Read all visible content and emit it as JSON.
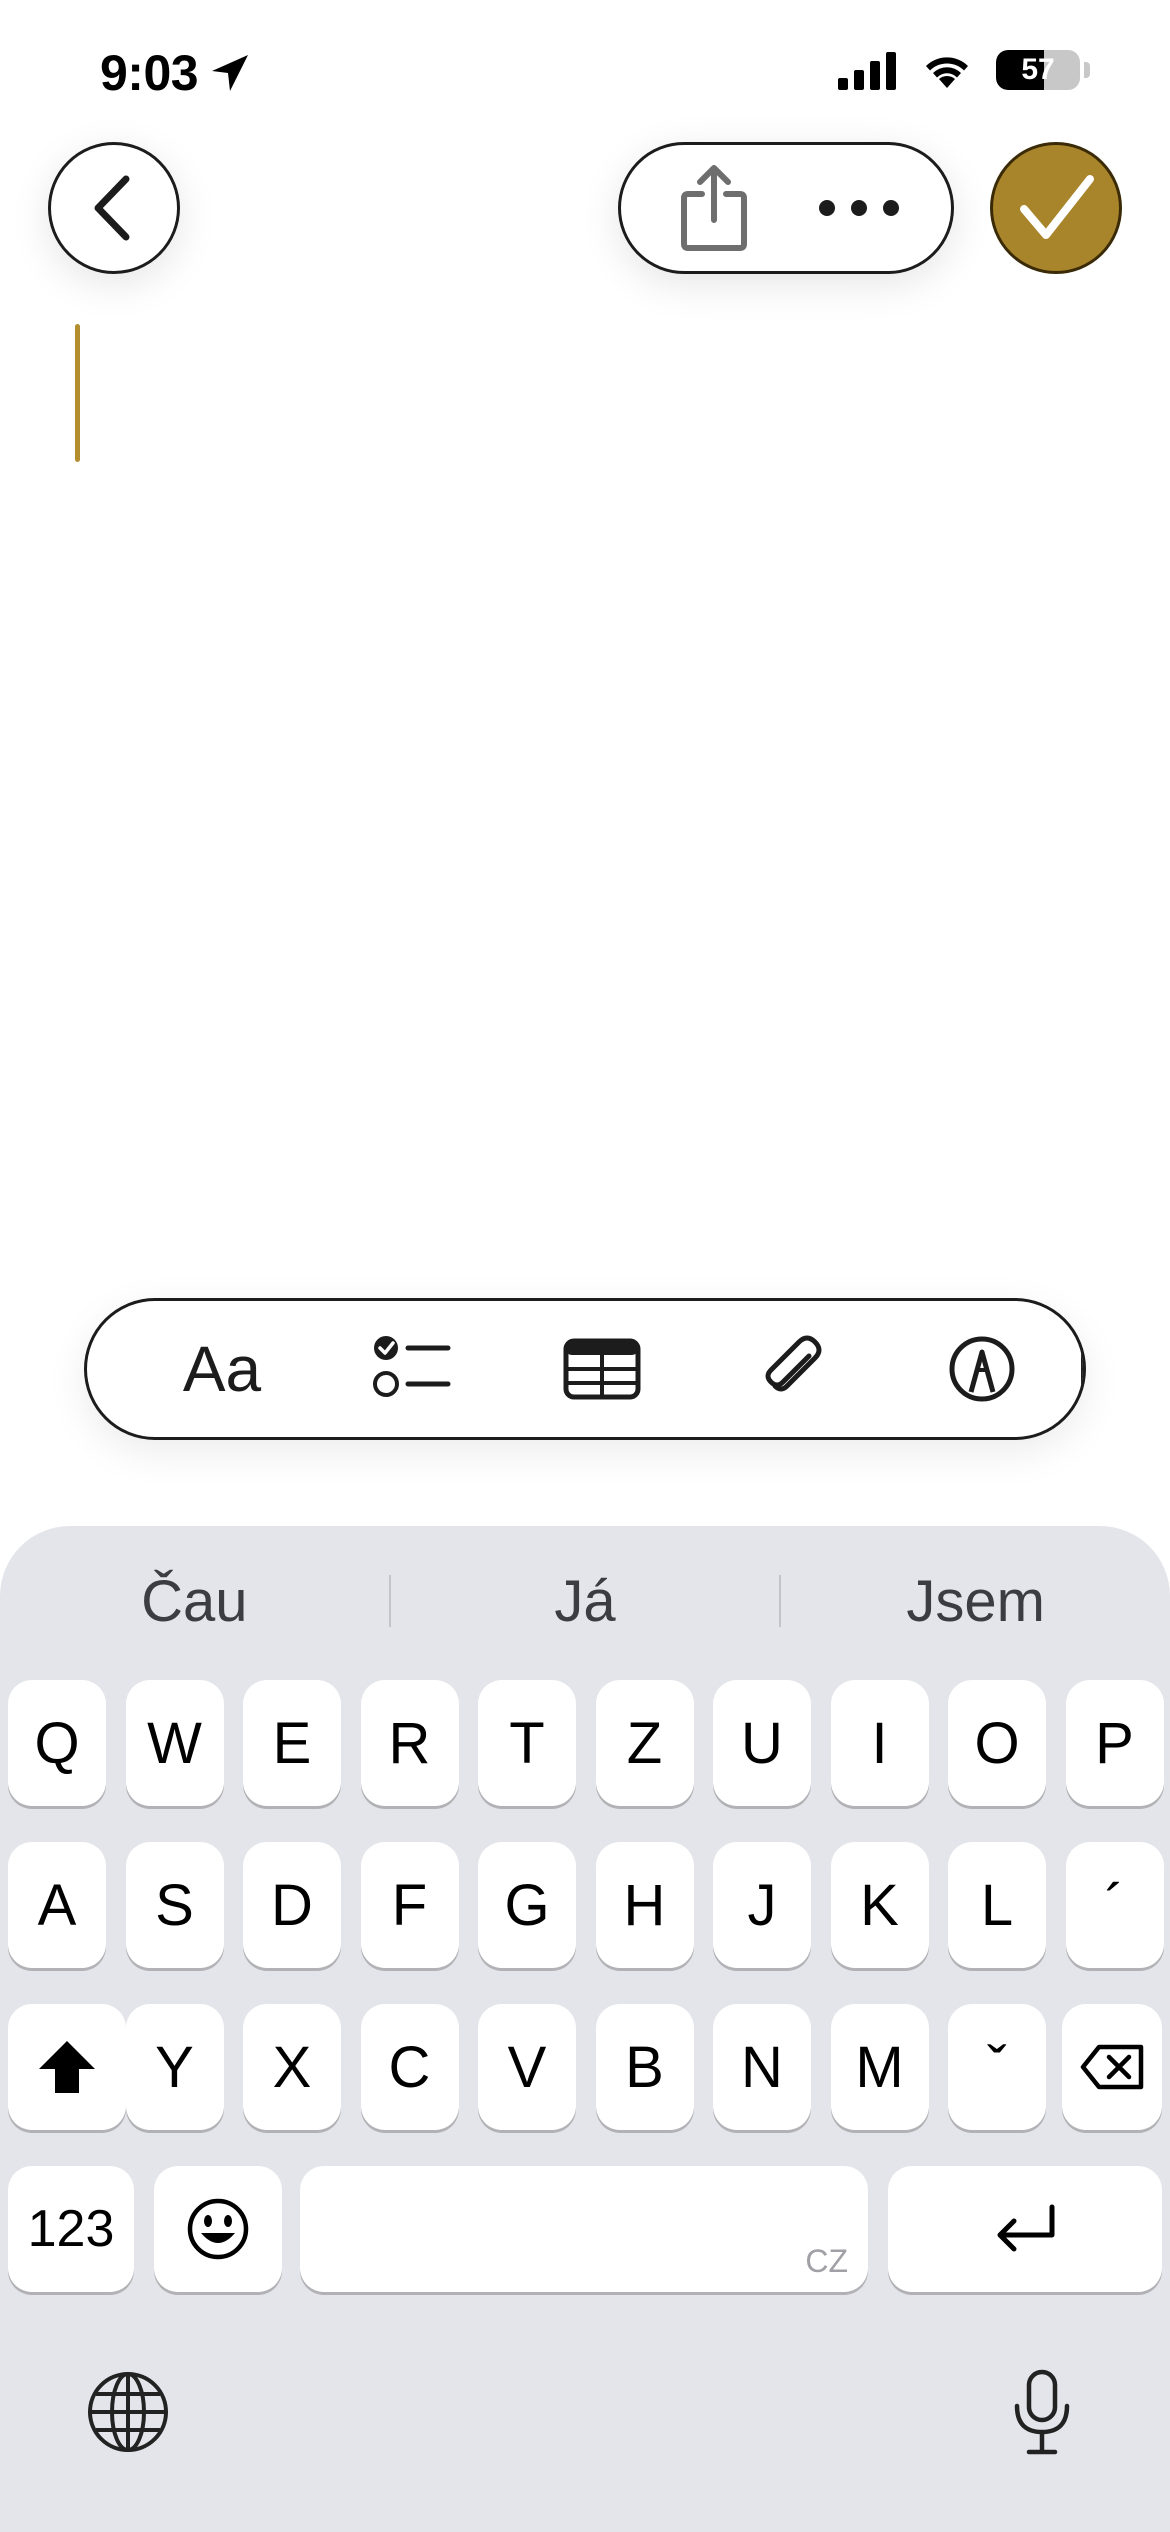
{
  "status_bar": {
    "time": "9:03",
    "battery_level": "57",
    "battery_fraction": 0.57
  },
  "nav": {
    "back_icon": "chevron-left-icon",
    "share_icon": "share-icon",
    "more_icon": "ellipsis-icon",
    "done_icon": "checkmark-icon",
    "accent_color": "#a8842a"
  },
  "format_toolbar": {
    "text_style_label": "Aa",
    "icons": [
      "text-style-icon",
      "checklist-icon",
      "table-icon",
      "attachment-icon",
      "markup-icon",
      "more-icon"
    ]
  },
  "keyboard": {
    "suggestions": [
      "Čau",
      "Já",
      "Jsem"
    ],
    "row1": [
      "Q",
      "W",
      "E",
      "R",
      "T",
      "Z",
      "U",
      "I",
      "O",
      "P"
    ],
    "row2": [
      "A",
      "S",
      "D",
      "F",
      "G",
      "H",
      "J",
      "K",
      "L",
      "´"
    ],
    "row3": [
      "Y",
      "X",
      "C",
      "V",
      "B",
      "N",
      "M",
      "ˇ"
    ],
    "numbers_label": "123",
    "space_label": "",
    "space_language": "CZ",
    "emoji_icon": "emoji-icon",
    "return_icon": "return-icon",
    "shift_icon": "shift-icon",
    "delete_icon": "delete-icon",
    "globe_icon": "globe-icon",
    "mic_icon": "microphone-icon"
  }
}
